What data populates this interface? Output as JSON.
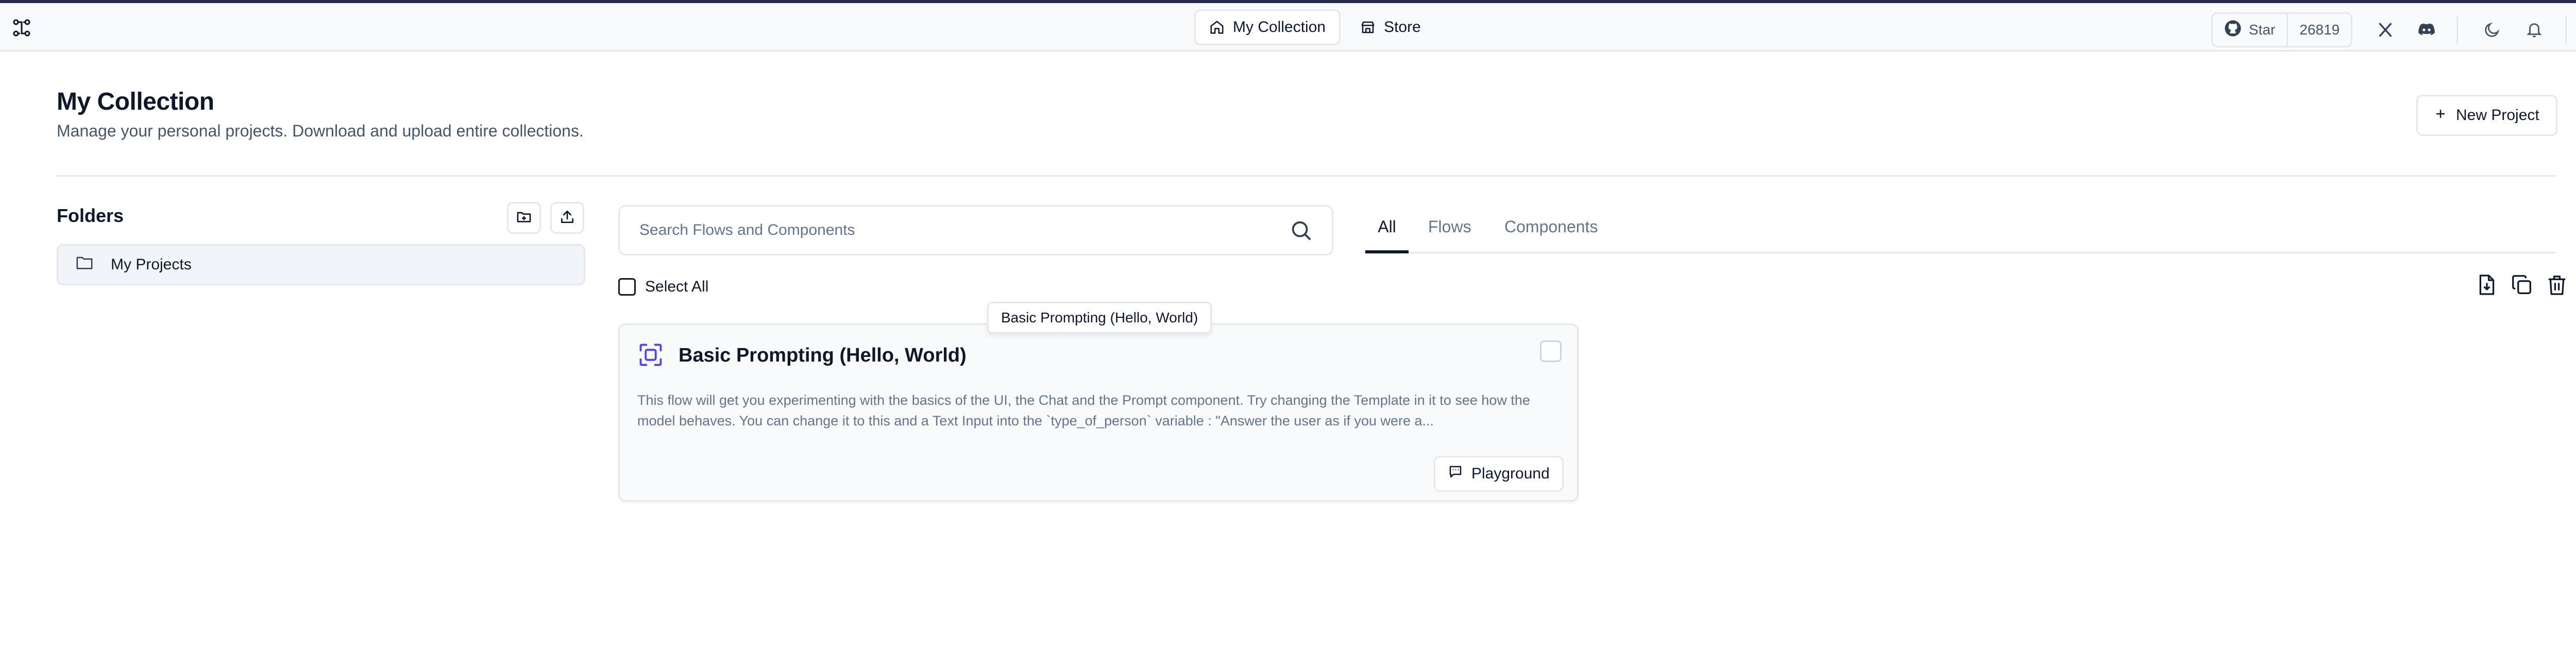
{
  "header": {
    "nav": [
      {
        "label": "My Collection",
        "icon": "home-icon",
        "active": true
      },
      {
        "label": "Store",
        "icon": "store-icon",
        "active": false
      }
    ],
    "github": {
      "star_label": "Star",
      "star_count": "26819"
    }
  },
  "page": {
    "title": "My Collection",
    "subtitle": "Manage your personal projects. Download and upload entire collections.",
    "new_project_label": "New Project"
  },
  "folders": {
    "title": "Folders",
    "items": [
      {
        "label": "My Projects",
        "icon": "folder-icon"
      }
    ]
  },
  "search": {
    "placeholder": "Search Flows and Components"
  },
  "tabs": [
    {
      "label": "All",
      "active": true
    },
    {
      "label": "Flows",
      "active": false
    },
    {
      "label": "Components",
      "active": false
    }
  ],
  "select_all_label": "Select All",
  "tooltip": "Basic Prompting (Hello, World)",
  "cards": [
    {
      "title": "Basic Prompting (Hello, World)",
      "description": "This flow will get you experimenting with the basics of the UI, the Chat and the Prompt component. Try changing the Template in it to see how the model behaves. You can change it to this and a Text Input into the `type_of_person` variable : \"Answer the user as if you were a...",
      "action_label": "Playground"
    }
  ],
  "colors": {
    "accent_bar": "#262a4f",
    "icon_blue": "#4f46e5",
    "text_primary": "#0f172a",
    "text_muted": "#64748b",
    "border": "#e5e7eb"
  }
}
